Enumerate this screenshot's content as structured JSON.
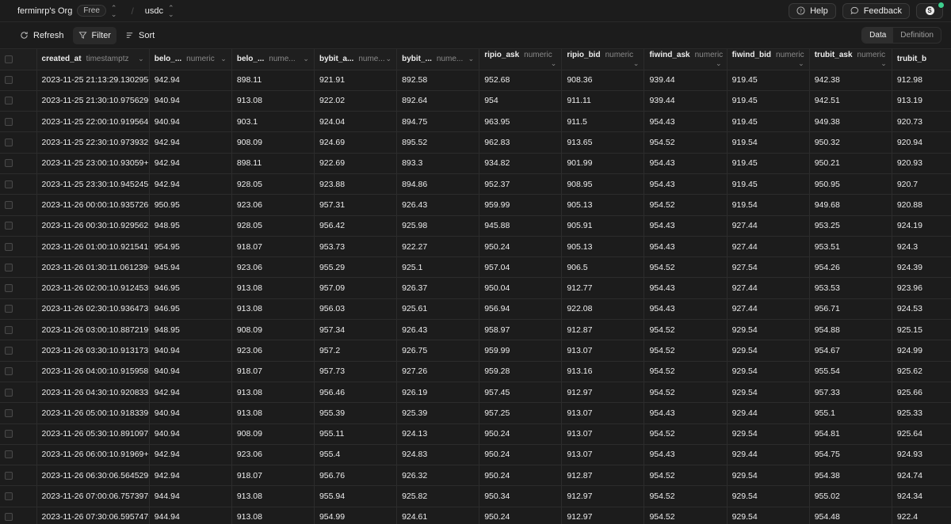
{
  "topbar": {
    "org": "ferminrp's Org",
    "plan": "Free",
    "project": "usdc",
    "help": "Help",
    "feedback": "Feedback",
    "avatar_initial": "S",
    "status_color": "#3ecf8e"
  },
  "toolbar": {
    "refresh": "Refresh",
    "filter": "Filter",
    "sort": "Sort",
    "view_data": "Data",
    "view_definition": "Definition"
  },
  "columns": [
    {
      "name": "created_at",
      "type": "timestamptz"
    },
    {
      "name": "belo_...",
      "type": "numeric"
    },
    {
      "name": "belo_...",
      "type": "nume..."
    },
    {
      "name": "bybit_a...",
      "type": "nume..."
    },
    {
      "name": "bybit_...",
      "type": "nume..."
    },
    {
      "name": "ripio_ask",
      "type": "numeric"
    },
    {
      "name": "ripio_bid",
      "type": "numeric"
    },
    {
      "name": "fiwind_ask",
      "type": "numeric"
    },
    {
      "name": "fiwind_bid",
      "type": "numeric"
    },
    {
      "name": "trubit_ask",
      "type": "numeric"
    },
    {
      "name": "trubit_b",
      "type": ""
    }
  ],
  "rows": [
    [
      "2023-11-25 21:13:29.130295+00",
      "942.94",
      "898.11",
      "921.91",
      "892.58",
      "952.68",
      "908.36",
      "939.44",
      "919.45",
      "942.38",
      "912.98"
    ],
    [
      "2023-11-25 21:30:10.975629+00",
      "940.94",
      "913.08",
      "922.02",
      "892.64",
      "954",
      "911.11",
      "939.44",
      "919.45",
      "942.51",
      "913.19"
    ],
    [
      "2023-11-25 22:00:10.919564+00",
      "940.94",
      "903.1",
      "924.04",
      "894.75",
      "963.95",
      "911.5",
      "954.43",
      "919.45",
      "949.38",
      "920.73"
    ],
    [
      "2023-11-25 22:30:10.973932+00",
      "942.94",
      "908.09",
      "924.69",
      "895.52",
      "962.83",
      "913.65",
      "954.52",
      "919.54",
      "950.32",
      "920.94"
    ],
    [
      "2023-11-25 23:00:10.93059+00",
      "942.94",
      "898.11",
      "922.69",
      "893.3",
      "934.82",
      "901.99",
      "954.43",
      "919.45",
      "950.21",
      "920.93"
    ],
    [
      "2023-11-25 23:30:10.945245+00",
      "942.94",
      "928.05",
      "923.88",
      "894.86",
      "952.37",
      "908.95",
      "954.43",
      "919.45",
      "950.95",
      "920.7"
    ],
    [
      "2023-11-26 00:00:10.935726+00",
      "950.95",
      "923.06",
      "957.31",
      "926.43",
      "959.99",
      "905.13",
      "954.52",
      "919.54",
      "949.68",
      "920.88"
    ],
    [
      "2023-11-26 00:30:10.929562+00",
      "948.95",
      "928.05",
      "956.42",
      "925.98",
      "945.88",
      "905.91",
      "954.43",
      "927.44",
      "953.25",
      "924.19"
    ],
    [
      "2023-11-26 01:00:10.921541+00",
      "954.95",
      "918.07",
      "953.73",
      "922.27",
      "950.24",
      "905.13",
      "954.43",
      "927.44",
      "953.51",
      "924.3"
    ],
    [
      "2023-11-26 01:30:11.061239+00",
      "945.94",
      "923.06",
      "955.29",
      "925.1",
      "957.04",
      "906.5",
      "954.52",
      "927.54",
      "954.26",
      "924.39"
    ],
    [
      "2023-11-26 02:00:10.912453+00",
      "946.95",
      "913.08",
      "957.09",
      "926.37",
      "950.04",
      "912.77",
      "954.43",
      "927.44",
      "953.53",
      "923.96"
    ],
    [
      "2023-11-26 02:30:10.936473+00",
      "946.95",
      "913.08",
      "956.03",
      "925.61",
      "956.94",
      "922.08",
      "954.43",
      "927.44",
      "956.71",
      "924.53"
    ],
    [
      "2023-11-26 03:00:10.887219+00",
      "948.95",
      "908.09",
      "957.34",
      "926.43",
      "958.97",
      "912.87",
      "954.52",
      "929.54",
      "954.88",
      "925.15"
    ],
    [
      "2023-11-26 03:30:10.913173+00",
      "940.94",
      "923.06",
      "957.2",
      "926.75",
      "959.99",
      "913.07",
      "954.52",
      "929.54",
      "954.67",
      "924.99"
    ],
    [
      "2023-11-26 04:00:10.915958+00",
      "940.94",
      "918.07",
      "957.73",
      "927.26",
      "959.28",
      "913.16",
      "954.52",
      "929.54",
      "955.54",
      "925.62"
    ],
    [
      "2023-11-26 04:30:10.920833+00",
      "942.94",
      "913.08",
      "956.46",
      "926.19",
      "957.45",
      "912.97",
      "954.52",
      "929.54",
      "957.33",
      "925.66"
    ],
    [
      "2023-11-26 05:00:10.918339+00",
      "940.94",
      "913.08",
      "955.39",
      "925.39",
      "957.25",
      "913.07",
      "954.43",
      "929.44",
      "955.1",
      "925.33"
    ],
    [
      "2023-11-26 05:30:10.891097+00",
      "940.94",
      "908.09",
      "955.11",
      "924.13",
      "950.24",
      "913.07",
      "954.52",
      "929.54",
      "954.81",
      "925.64"
    ],
    [
      "2023-11-26 06:00:10.91969+00",
      "942.94",
      "923.06",
      "955.4",
      "924.83",
      "950.24",
      "913.07",
      "954.43",
      "929.44",
      "954.75",
      "924.93"
    ],
    [
      "2023-11-26 06:30:06.564529+00",
      "942.94",
      "918.07",
      "956.76",
      "926.32",
      "950.24",
      "912.87",
      "954.52",
      "929.54",
      "954.38",
      "924.74"
    ],
    [
      "2023-11-26 07:00:06.757397+00",
      "944.94",
      "913.08",
      "955.94",
      "925.82",
      "950.34",
      "912.97",
      "954.52",
      "929.54",
      "955.02",
      "924.34"
    ],
    [
      "2023-11-26 07:30:06.595747+00",
      "944.94",
      "913.08",
      "954.99",
      "924.61",
      "950.24",
      "912.97",
      "954.52",
      "929.54",
      "954.48",
      "922.4"
    ]
  ]
}
